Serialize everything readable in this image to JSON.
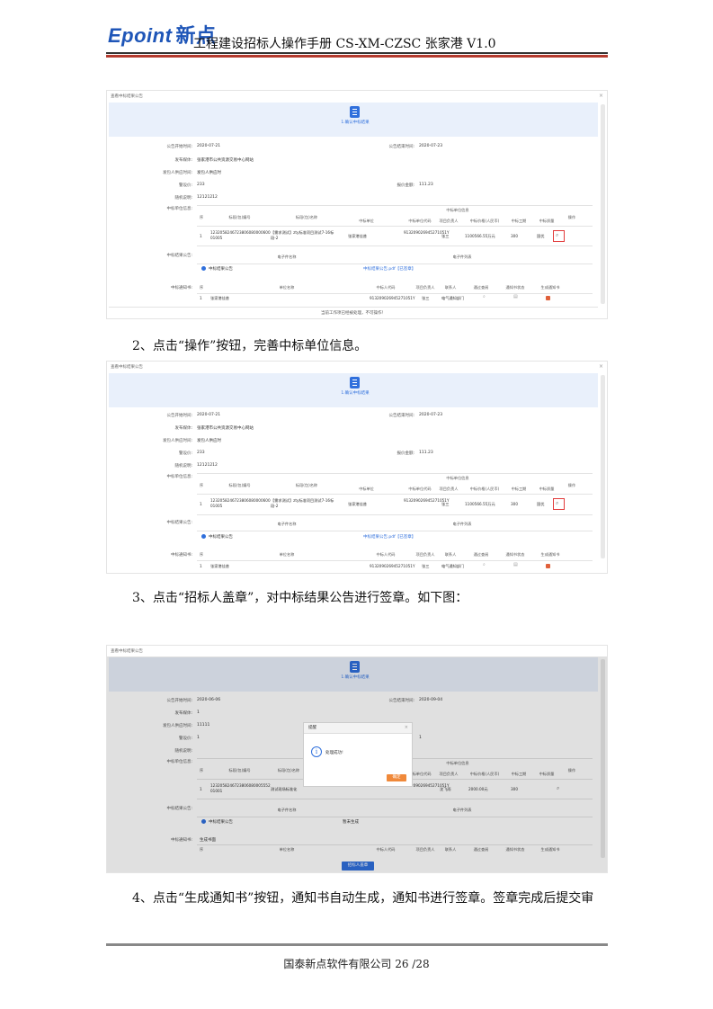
{
  "header": {
    "logo_latin": "Epoint",
    "logo_cn": "新点",
    "title": "工程建设招标人操作手册 CS-XM-CZSC 张家港 V1.0"
  },
  "steps": {
    "step2": "2、点击“操作”按钮，完善中标单位信息。",
    "step3": "3、点击“招标人盖章”，对中标结果公告进行签章。如下图：",
    "step4": "4、点击“生成通知书”按钮，通知书自动生成，通知书进行签章。签章完成后提交审"
  },
  "footer": {
    "text": "国泰新点软件有限公司 26 /28"
  },
  "shot1": {
    "window_title": "查看中标结果公告",
    "step_label": "1.确认中标结果",
    "fields": [
      {
        "label": "公告开始时间:",
        "value": "2020-07-21"
      },
      {
        "label": "发布媒体:",
        "value": "张家港市公共资源交易中心网站"
      },
      {
        "label": "发包人供应时间:",
        "value": "发包人供应时"
      },
      {
        "label": "警设价:",
        "value": "233"
      },
      {
        "label": "随机说明:",
        "value": "12121212"
      }
    ],
    "end_label": "公告结束时间:",
    "end_value": "2020-07-23",
    "amount_label": "报价金额:",
    "amount_value": "111.23",
    "winner_section": "中标单位信息:",
    "group_header": "中标单位信息",
    "headers": [
      "序",
      "标段(包)编号",
      "标段(包)名称",
      "中标单位",
      "中标单位代码",
      "项目负责人",
      "中标价格(人民币)",
      "中标工期",
      "中标质量",
      "操作"
    ],
    "row": {
      "no": "1",
      "code": "1232058246723806080000600 01005",
      "name": "【需求测试】zty标准项目测试7-16标段-2",
      "unit": "张家港佳普",
      "unit_code": "913209026945271051Y",
      "pm": "张三",
      "price": "1100566.55万元",
      "period": "300",
      "quality": "国优"
    },
    "pub_section": "中标结果公告:",
    "ef_header": "电子件名称",
    "pf_header": "电子件列表",
    "doc_name": "中标结果公告",
    "doc_link": "中标结果公告.pdf【已签章】",
    "notice_section": "中标通知书:",
    "notice_headers": [
      "序",
      "单位名称",
      "中标人代码",
      "项目负责人",
      "联系人",
      "通过查阅",
      "通知书状态",
      "生成通知书"
    ],
    "notice_row": {
      "no": "1",
      "unit": "张家港佳普",
      "code": "913209026945271051Y",
      "pm": "张三",
      "contact": "电气通知部门"
    },
    "bottom_text": "当前工作项已经被处理，不可操作！"
  },
  "shot2": {
    "window_title": "查看中标结果公告",
    "step_label": "1.确认中标结果"
  },
  "shot3": {
    "window_title": "查看中标结果公告",
    "step_label": "1.确认中标结果",
    "start_value": "2020-06-06",
    "end_value": "2020-09-04",
    "media_value": "1",
    "supply_value": "11111",
    "price_value": "1",
    "amount_value": "1",
    "row": {
      "no": "1",
      "code": "1232058246723806080005552 01001",
      "name": "测试现场标准化",
      "unit_code": "913209026945271051Y",
      "pm": "沈飞雨",
      "price": "2000.00元",
      "period": "300"
    },
    "dialog_title": "提醒",
    "dialog_msg": "处理成功!",
    "dialog_btn": "确定",
    "doc_name": "中标结果公告",
    "doc_state": "暂未生成",
    "notice_btn": "生成书面",
    "seal_btn": "招标人盖章"
  }
}
